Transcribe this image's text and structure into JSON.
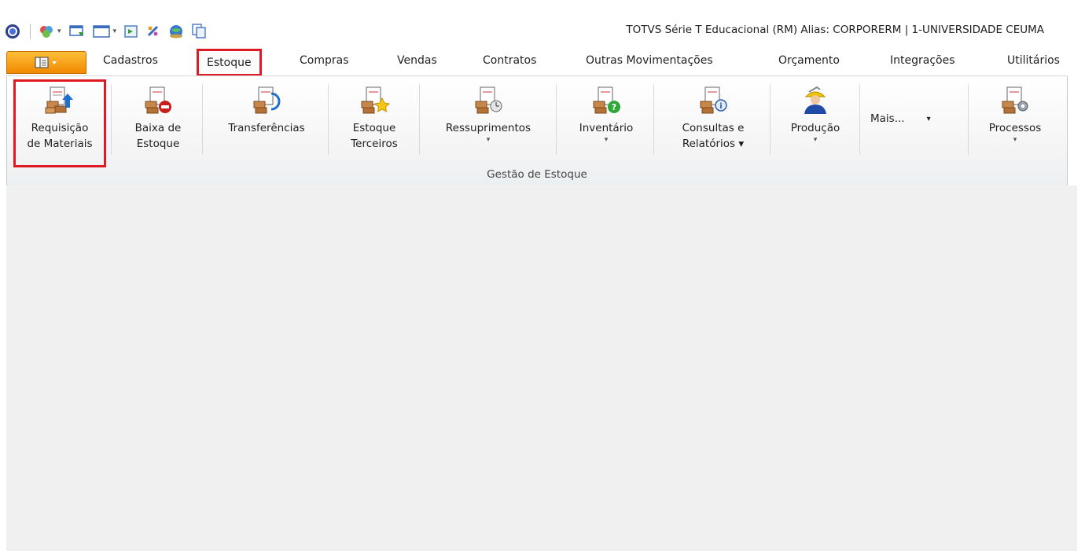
{
  "window": {
    "title": "TOTVS Série T Educacional (RM) Alias: CORPORERM | 1-UNIVERSIDADE CEUMA"
  },
  "quick_access": {
    "icons": [
      "app-orb-icon",
      "modules-icon",
      "window-restore-icon",
      "window-icon",
      "export-icon",
      "palette-icon",
      "globe-icon",
      "copy-icon"
    ]
  },
  "tabs": [
    {
      "label": "Cadastros"
    },
    {
      "label": "Estoque",
      "active": true
    },
    {
      "label": "Compras"
    },
    {
      "label": "Vendas"
    },
    {
      "label": "Contratos"
    },
    {
      "label": "Outras Movimentações"
    },
    {
      "label": "Orçamento"
    },
    {
      "label": "Integrações"
    },
    {
      "label": "Utilitários"
    }
  ],
  "ribbon": {
    "group_label": "Gestão de Estoque",
    "buttons": [
      {
        "line1": "Requisição",
        "line2": "de Materiais",
        "icon": "material-request-icon"
      },
      {
        "line1": "Baixa de",
        "line2": "Estoque",
        "icon": "stock-writeoff-icon"
      },
      {
        "line1": "Transferências",
        "line2": "",
        "icon": "transfer-icon"
      },
      {
        "line1": "Estoque",
        "line2": "Terceiros",
        "icon": "third-party-stock-icon"
      },
      {
        "line1": "Ressuprimentos",
        "line2": "▾",
        "icon": "resupply-icon"
      },
      {
        "line1": "Inventário",
        "line2": "▾",
        "icon": "inventory-icon"
      },
      {
        "line1": "Consultas e",
        "line2": "Relatórios ▾",
        "icon": "reports-icon"
      },
      {
        "line1": "Produção",
        "line2": "▾",
        "icon": "production-icon"
      },
      {
        "line1": "Mais...",
        "line2": "▾",
        "icon": ""
      },
      {
        "line1": "Processos",
        "line2": "▾",
        "icon": "processes-icon"
      }
    ]
  },
  "colors": {
    "highlight": "#e01a22",
    "file_tab": "#f39a10",
    "workspace": "#f0f0f0"
  }
}
